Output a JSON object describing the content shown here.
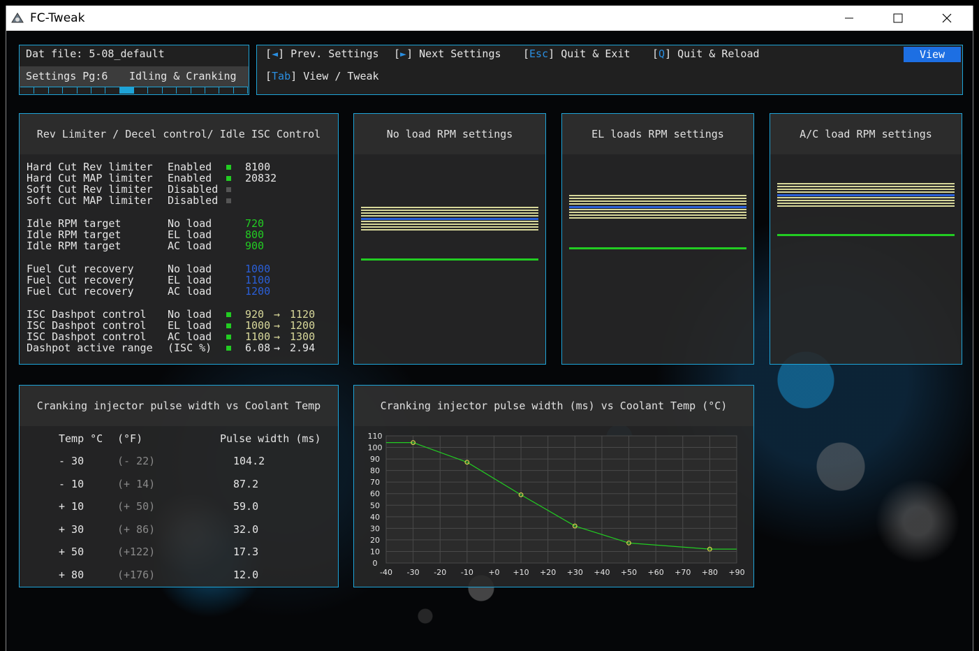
{
  "window": {
    "title": "FC-Tweak"
  },
  "status": {
    "dat_label": "Dat file:",
    "dat_file": "5-08_default",
    "settings_page": "Settings Pg:6",
    "settings_name": "Idling & Cranking",
    "page_count": 16,
    "active_page": 7
  },
  "keys": {
    "prev": {
      "key": "◄",
      "label": "Prev. Settings"
    },
    "next": {
      "key": "►",
      "label": "Next Settings"
    },
    "esc": {
      "key": "Esc",
      "label": "Quit & Exit"
    },
    "q": {
      "key": "Q",
      "label": "Quit & Reload"
    },
    "tab": {
      "key": "Tab",
      "label": "View / Tweak"
    },
    "mode": "View"
  },
  "rev_panel": {
    "title": "Rev Limiter / Decel control/ Idle ISC Control",
    "limiters": [
      {
        "name": "Hard Cut Rev limiter",
        "state": "Enabled",
        "on": true,
        "value": "8100"
      },
      {
        "name": "Hard Cut MAP limiter",
        "state": "Enabled",
        "on": true,
        "value": "20832"
      },
      {
        "name": "Soft Cut Rev limiter",
        "state": "Disabled",
        "on": false,
        "value": ""
      },
      {
        "name": "Soft Cut MAP limiter",
        "state": "Disabled",
        "on": false,
        "value": ""
      }
    ],
    "idle": [
      {
        "name": "Idle RPM target",
        "load": "No load",
        "value": "720"
      },
      {
        "name": "Idle RPM target",
        "load": "EL load",
        "value": "800"
      },
      {
        "name": "Idle RPM target",
        "load": "AC load",
        "value": "900"
      }
    ],
    "fuelcut": [
      {
        "name": "Fuel Cut recovery",
        "load": "No load",
        "value": "1000"
      },
      {
        "name": "Fuel Cut recovery",
        "load": "EL load",
        "value": "1100"
      },
      {
        "name": "Fuel Cut recovery",
        "load": "AC load",
        "value": "1200"
      }
    ],
    "dashpot": [
      {
        "name": "ISC Dashpot control",
        "load": "No load",
        "from": "920",
        "arrow": "→",
        "to": "1120"
      },
      {
        "name": "ISC Dashpot control",
        "load": "EL load",
        "from": "1000",
        "arrow": "→",
        "to": "1200"
      },
      {
        "name": "ISC Dashpot control",
        "load": "AC load",
        "from": "1100",
        "arrow": "→",
        "to": "1300"
      },
      {
        "name": "Dashpot active range",
        "load": "(ISC %)",
        "from": "6.08",
        "arrow": "→",
        "to": "2.94"
      }
    ]
  },
  "rpm_panels": [
    {
      "title": "No load RPM settings"
    },
    {
      "title": "EL loads RPM settings"
    },
    {
      "title": "A/C load RPM settings"
    }
  ],
  "colors": {
    "accent": "#1ea4d8",
    "green": "#22cc22",
    "blue": "#2a5fd8",
    "yellow": "#d8d89a",
    "view_button": "#1d6fe3"
  },
  "crank_table": {
    "title": "Cranking injector pulse width vs Coolant Temp",
    "headers": {
      "temp_c": "Temp °C",
      "temp_f": "(°F)",
      "pulse": "Pulse width (ms)"
    },
    "rows": [
      {
        "c": "- 30",
        "f": "(- 22)",
        "pw": "104.2"
      },
      {
        "c": "- 10",
        "f": "(+ 14)",
        "pw": "87.2"
      },
      {
        "c": "+ 10",
        "f": "(+ 50)",
        "pw": "59.0"
      },
      {
        "c": "+ 30",
        "f": "(+ 86)",
        "pw": "32.0"
      },
      {
        "c": "+ 50",
        "f": "(+122)",
        "pw": "17.3"
      },
      {
        "c": "+ 80",
        "f": "(+176)",
        "pw": "12.0"
      }
    ]
  },
  "chart_data": {
    "type": "line",
    "title": "Cranking injector pulse width (ms) vs Coolant Temp (°C)",
    "x_ticks": [
      "-40",
      "-30",
      "-20",
      "-10",
      "+0",
      "+10",
      "+20",
      "+30",
      "+40",
      "+50",
      "+60",
      "+70",
      "+80",
      "+90"
    ],
    "y_ticks": [
      "0",
      "10",
      "20",
      "30",
      "40",
      "50",
      "60",
      "70",
      "80",
      "90",
      "100",
      "110"
    ],
    "xlim": [
      -40,
      90
    ],
    "ylim": [
      0,
      110
    ],
    "grid": true,
    "points": [
      {
        "x": -30,
        "y": 104.2
      },
      {
        "x": -10,
        "y": 87.2
      },
      {
        "x": 10,
        "y": 59.0
      },
      {
        "x": 30,
        "y": 32.0
      },
      {
        "x": 50,
        "y": 17.3
      },
      {
        "x": 80,
        "y": 12.0
      }
    ],
    "line_extends": {
      "x_start": -40,
      "x_end": 90
    },
    "line_color": "#22cc22",
    "marker_color": "#d8d84a"
  }
}
